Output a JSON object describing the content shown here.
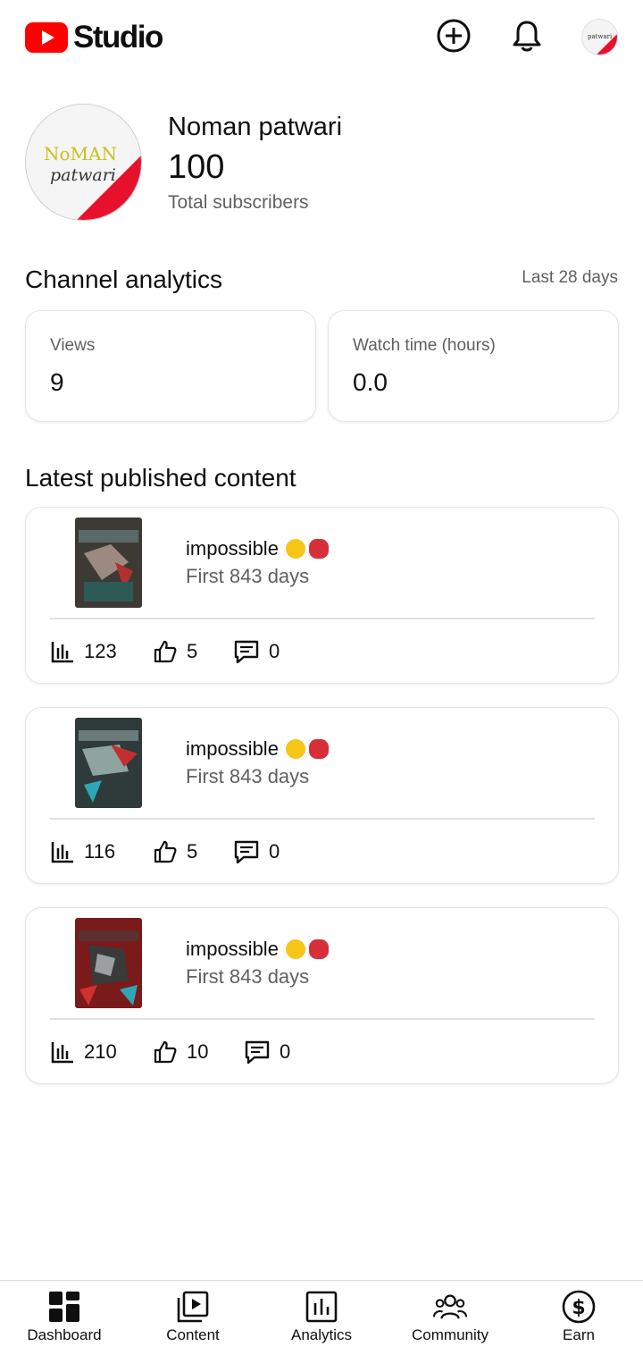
{
  "app": {
    "logo_text": "Studio"
  },
  "header": {
    "create_icon": "add-circle-icon",
    "notifications_icon": "bell-icon",
    "avatar_text": "patwari"
  },
  "channel": {
    "avatar_text_top": "NoMAN",
    "avatar_text_bottom": "patwari",
    "name": "Noman patwari",
    "subscribers": "100",
    "subscribers_label": "Total subscribers"
  },
  "analytics": {
    "title": "Channel analytics",
    "period": "Last 28 days",
    "cards": [
      {
        "label": "Views",
        "value": "9"
      },
      {
        "label": "Watch time (hours)",
        "value": "0.0"
      }
    ]
  },
  "latest": {
    "title": "Latest published content",
    "items": [
      {
        "title": "impossible",
        "subtitle": "First 843 days",
        "views": "123",
        "likes": "5",
        "comments": "0"
      },
      {
        "title": "impossible",
        "subtitle": "First 843 days",
        "views": "116",
        "likes": "5",
        "comments": "0"
      },
      {
        "title": "impossible",
        "subtitle": "First 843 days",
        "views": "210",
        "likes": "10",
        "comments": "0"
      }
    ]
  },
  "nav": {
    "items": [
      {
        "label": "Dashboard",
        "icon": "dashboard-icon"
      },
      {
        "label": "Content",
        "icon": "content-icon"
      },
      {
        "label": "Analytics",
        "icon": "analytics-icon"
      },
      {
        "label": "Community",
        "icon": "community-icon"
      },
      {
        "label": "Earn",
        "icon": "dollar-icon"
      }
    ]
  },
  "colors": {
    "brand": "#ff0000",
    "text": "#0f0f0f",
    "secondary": "#606060"
  }
}
